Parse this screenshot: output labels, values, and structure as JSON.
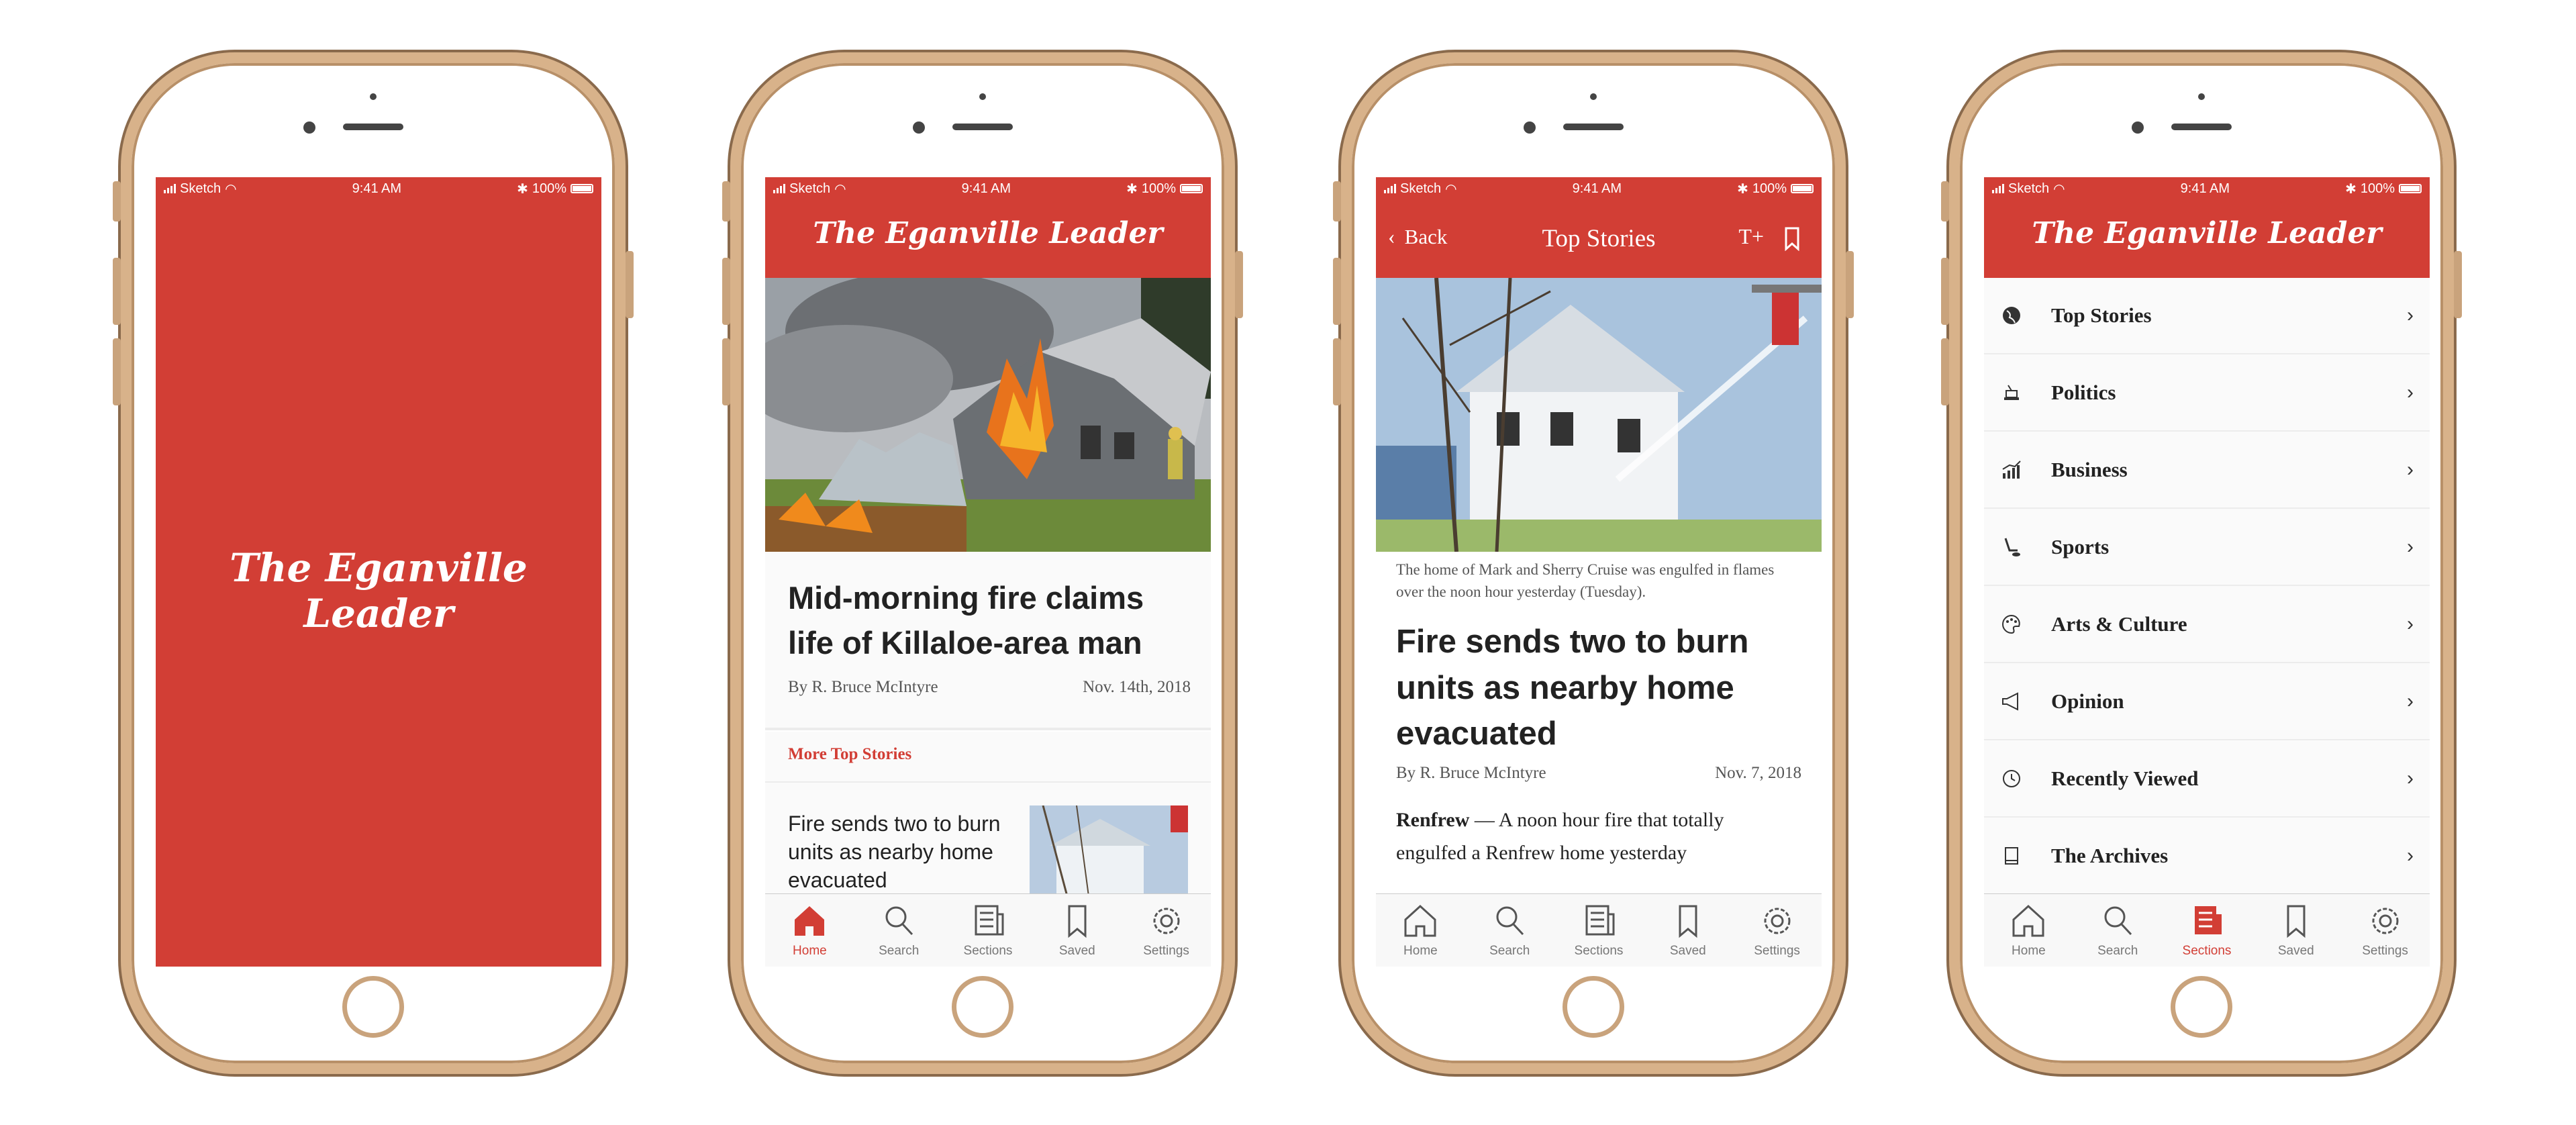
{
  "status": {
    "carrier": "Sketch",
    "time": "9:41 AM",
    "battery": "100%"
  },
  "brand": {
    "masthead": "The Eganville Leader",
    "accent": "#d23e35"
  },
  "tabs": [
    {
      "label": "Home",
      "icon": "home-icon"
    },
    {
      "label": "Search",
      "icon": "search-icon"
    },
    {
      "label": "Sections",
      "icon": "sections-icon"
    },
    {
      "label": "Saved",
      "icon": "bookmark-icon"
    },
    {
      "label": "Settings",
      "icon": "gear-icon"
    }
  ],
  "home": {
    "headline": "Mid-morning fire claims life of Killaloe-area man",
    "byline": "By R. Bruce McIntyre",
    "date": "Nov. 14th, 2018",
    "more_label": "More Top Stories",
    "more_item": "Fire sends two to burn units as nearby home evacuated"
  },
  "article": {
    "back_label": "Back",
    "title": "Top Stories",
    "text_size_label": "T+",
    "caption": "The home of Mark and Sherry Cruise was engulfed in flames over the noon hour yesterday (Tuesday).",
    "headline": "Fire sends two to burn units as nearby home evacuated",
    "byline": "By R. Bruce McIntyre",
    "date": "Nov. 7, 2018",
    "lead_bold": "Renfrew",
    "lead_text": " — A noon hour fire that totally engulfed a Renfrew home yesterday"
  },
  "sections": {
    "items": [
      {
        "label": "Top Stories",
        "icon": "globe-icon"
      },
      {
        "label": "Politics",
        "icon": "podium-icon"
      },
      {
        "label": "Business",
        "icon": "chart-icon"
      },
      {
        "label": "Sports",
        "icon": "hockey-icon"
      },
      {
        "label": "Arts & Culture",
        "icon": "palette-icon"
      },
      {
        "label": "Opinion",
        "icon": "megaphone-icon"
      },
      {
        "label": "Recently Viewed",
        "icon": "history-icon"
      },
      {
        "label": "The Archives",
        "icon": "book-icon"
      }
    ]
  }
}
